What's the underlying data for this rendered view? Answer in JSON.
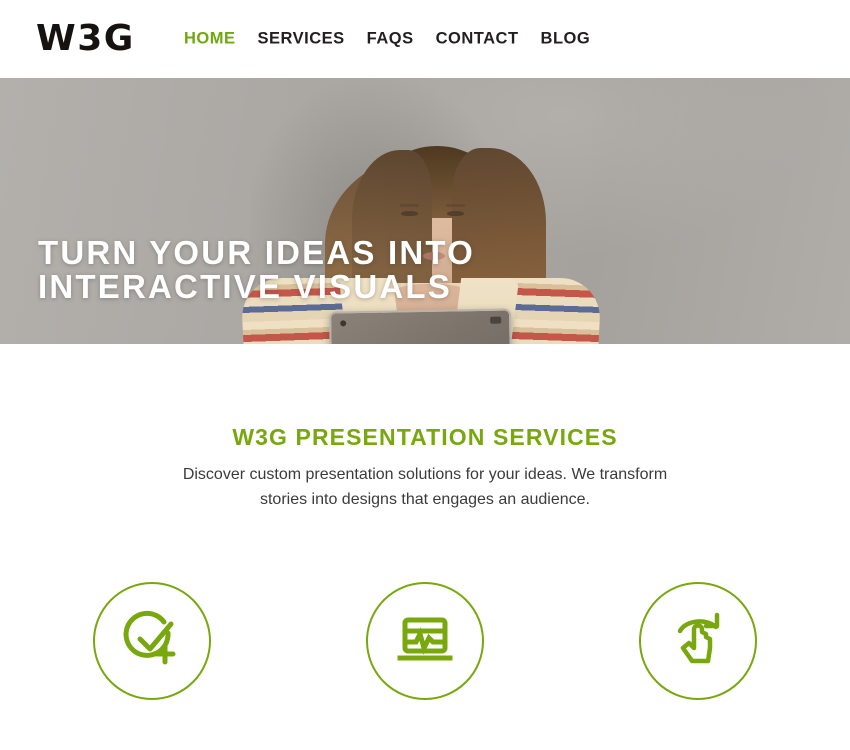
{
  "brand": {
    "logo_text": "W3G",
    "accent_color": "#78a80d",
    "dark_color": "#231f20"
  },
  "nav": {
    "items": [
      {
        "label": "HOME",
        "active": true
      },
      {
        "label": "SERVICES",
        "active": false
      },
      {
        "label": "FAQS",
        "active": false
      },
      {
        "label": "CONTACT",
        "active": false
      },
      {
        "label": "BLOG",
        "active": false
      }
    ]
  },
  "hero": {
    "title": "TURN YOUR IDEAS INTO\nINTERACTIVE VISUALS",
    "background_color": "#aba8a4",
    "image_description": "Woman holding a tablet against a grey wall"
  },
  "services": {
    "title": "W3G PRESENTATION SERVICES",
    "description": "Discover custom presentation solutions for your ideas. We transform stories into designs that engages an audience.",
    "icons": [
      {
        "name": "check-circle-plus-icon"
      },
      {
        "name": "laptop-chart-icon"
      },
      {
        "name": "hand-pointer-refresh-icon"
      }
    ]
  }
}
